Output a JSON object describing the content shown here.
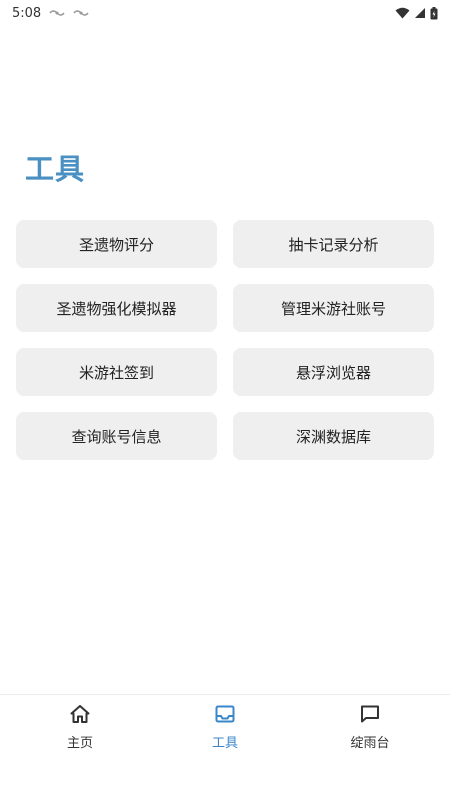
{
  "status_bar": {
    "time": "5:08"
  },
  "page": {
    "title": "工具"
  },
  "tools": [
    {
      "label": "圣遗物评分"
    },
    {
      "label": "抽卡记录分析"
    },
    {
      "label": "圣遗物强化模拟器"
    },
    {
      "label": "管理米游社账号"
    },
    {
      "label": "米游社签到"
    },
    {
      "label": "悬浮浏览器"
    },
    {
      "label": "查询账号信息"
    },
    {
      "label": "深渊数据库"
    }
  ],
  "bottom_nav": {
    "items": [
      {
        "label": "主页",
        "icon": "home-icon"
      },
      {
        "label": "工具",
        "icon": "inbox-icon",
        "active": true
      },
      {
        "label": "绽雨台",
        "icon": "chat-icon"
      }
    ]
  },
  "colors": {
    "accent": "#4a90c2",
    "active_nav": "#3a86c8",
    "button_bg": "#efefef"
  }
}
